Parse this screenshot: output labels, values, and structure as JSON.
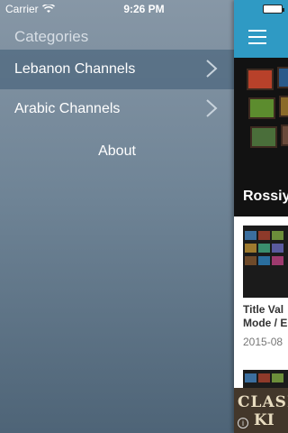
{
  "status_bar": {
    "carrier": "Carrier",
    "time": "9:26 PM"
  },
  "drawer": {
    "header": "Categories",
    "items": [
      {
        "label": "Lebanon Channels",
        "selected": true
      },
      {
        "label": "Arabic Channels",
        "selected": false
      }
    ],
    "about": "About"
  },
  "content": {
    "hero_title": "Rossiy",
    "card": {
      "title_line1": "Title Val",
      "title_line2": "Mode / E",
      "date": "2015-08"
    },
    "ad": {
      "line1": "CLASH",
      "line2": "KI"
    }
  },
  "colors": {
    "nav_bar": "#2f9ac4",
    "drawer_bottom": "#4e6477"
  }
}
